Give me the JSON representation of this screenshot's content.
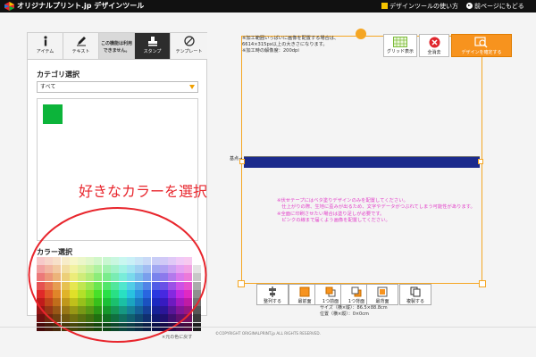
{
  "header": {
    "brand": "オリジナルプリント.jp デザインツール",
    "howto_link": "デザインツールの使い方",
    "back_link": "前ページにもどる"
  },
  "tabs": [
    {
      "label": "アイテム",
      "icon": "info-icon"
    },
    {
      "label": "テキスト",
      "icon": "pen-icon"
    },
    {
      "label": "この機能は利用できません。",
      "icon": ""
    },
    {
      "label": "スタンプ",
      "icon": "stamp-icon"
    },
    {
      "label": "テンプレート",
      "icon": "compass-icon"
    }
  ],
  "category": {
    "title": "カテゴリ選択",
    "selected": "すべて",
    "swatch_color": "#0cb43a"
  },
  "color_picker": {
    "title": "カラー選択",
    "reset_link": "×元の色に戻す"
  },
  "annotation": {
    "text": "好きなカラーを選択",
    "color": "#e8262d"
  },
  "toolbar": {
    "grid_label": "グリッド表示",
    "clear_label": "全消去",
    "confirm_label": "デザインを確定する"
  },
  "canvas": {
    "notes": [
      "※加工範囲いっぱいに画像を配置する場合は、",
      "6614×315px以上の大きさになります。",
      "※加工時の解像度：200dpi"
    ],
    "start_label": "基点→",
    "bar_color": "#1b2a8c",
    "warnings": [
      "※伏せテープにはベタ塗りデザインのみを配置してください。",
      "　仕上がりの際、生地に歪みが出るため、文字やデータがつぶれてしまう可能性があります。",
      "※全面に印刷させたい場合は塗り足しが必要です。",
      "　ピンクの線まで届くよう画像を配置してください。"
    ]
  },
  "bottom_tools": [
    {
      "label": "整列する",
      "icon": "align-icon"
    },
    {
      "label": "最前面",
      "icon": "bring-front-icon"
    },
    {
      "label": "1つ前面",
      "icon": "bring-forward-icon"
    },
    {
      "label": "1つ背面",
      "icon": "send-backward-icon"
    },
    {
      "label": "最背面",
      "icon": "send-back-icon"
    },
    {
      "label": "複製する",
      "icon": "duplicate-icon"
    }
  ],
  "size_info": [
    "サイズ（横×縦）：86.5×88.8cm",
    "位置（横×縦）：0×0cm"
  ],
  "footer": {
    "copyright": "©COPYRIGHT ORIGINALPRINT.jp ALL RIGHTS RESERVED."
  },
  "accent_color": "#f7931e"
}
